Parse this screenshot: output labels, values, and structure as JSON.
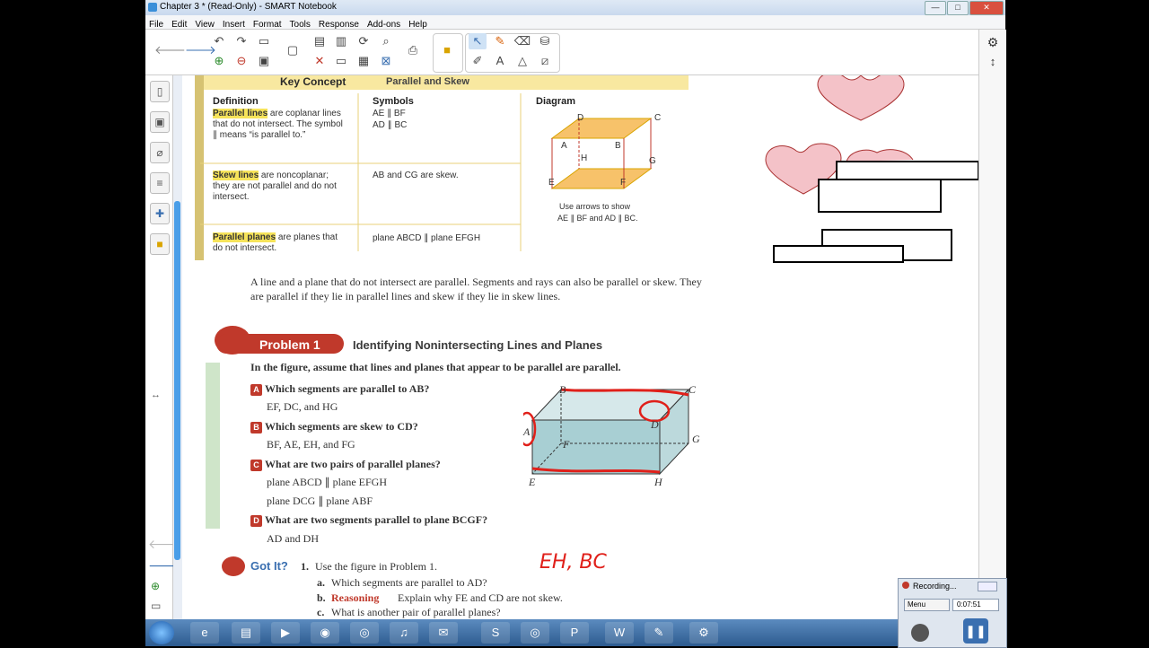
{
  "window": {
    "title": "Chapter 3 * (Read-Only) - SMART Notebook",
    "controls": {
      "minimize": "—",
      "maximize": "□",
      "close": "✕"
    }
  },
  "menu": [
    "File",
    "Edit",
    "View",
    "Insert",
    "Format",
    "Tools",
    "Response",
    "Add-ons",
    "Help"
  ],
  "key_concept": {
    "title": "Key Concept",
    "subtitle": "Parallel and Skew",
    "headers": {
      "definition": "Definition",
      "symbols": "Symbols",
      "diagram": "Diagram"
    },
    "rows": [
      {
        "term": "Parallel lines",
        "rest": " are coplanar lines that do not intersect. The symbol ∥ means “is parallel to.”",
        "sym1": "AE ∥ BF",
        "sym2": "AD ∥ BC"
      },
      {
        "term": "Skew lines",
        "rest": " are noncoplanar; they are not parallel and do not intersect.",
        "sym1": "AB and CG are skew.",
        "sym2": ""
      },
      {
        "term": "Parallel planes",
        "rest": " are planes that do not intersect.",
        "sym1": "plane ABCD ∥ plane EFGH",
        "sym2": ""
      }
    ],
    "diagram_note_1": "Use arrows to show",
    "diagram_note_2": "AE ∥ BF and AD ∥ BC.",
    "vertices": {
      "A": "A",
      "B": "B",
      "C": "C",
      "D": "D",
      "E": "E",
      "F": "F",
      "G": "G",
      "H": "H"
    }
  },
  "paragraph": "A line and a plane that do not intersect are parallel. Segments and rays can also be parallel or skew. They are parallel if they lie in parallel lines and skew if they lie in skew lines.",
  "problem": {
    "label": "Problem 1",
    "title": "Identifying Nonintersecting Lines and Planes",
    "intro": "In the figure, assume that lines and planes that appear to be parallel are parallel.",
    "items": [
      {
        "letter": "A",
        "question": "Which segments are parallel to AB?",
        "answer": "EF, DC, and HG"
      },
      {
        "letter": "B",
        "question": "Which segments are skew to CD?",
        "answer": "BF, AE, EH, and FG"
      },
      {
        "letter": "C",
        "question": "What are two pairs of parallel planes?",
        "answer": "plane ABCD ∥ plane EFGH",
        "answer2": "plane DCG ∥ plane ABF"
      },
      {
        "letter": "D",
        "question": "What are two segments parallel to plane BCGF?",
        "answer": "AD and DH"
      }
    ]
  },
  "got_it": {
    "label": "Got It?",
    "number": "1.",
    "text": "Use the figure in Problem 1.",
    "a": "a.",
    "a_text": "Which segments are parallel to AD?",
    "b": "b.",
    "b_label": "Reasoning",
    "b_text": "Explain why FE and CD are not skew.",
    "c": "c.",
    "c_text": "What is another pair of parallel planes?"
  },
  "handwriting": "EH, BC",
  "recorder": {
    "title": "Recording...",
    "menu": "Menu",
    "time": "0:07:51"
  },
  "colors": {
    "accent_red": "#c0392b",
    "highlight": "#f6e35a",
    "heart": "#f4c2c8",
    "ink_red": "#e0201a",
    "taskbar": "#2d5b8f"
  }
}
